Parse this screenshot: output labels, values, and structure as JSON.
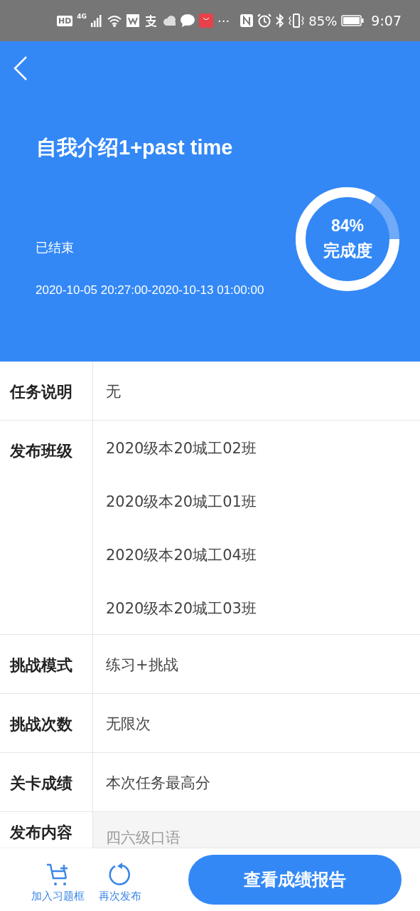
{
  "status_bar": {
    "hd": "HD",
    "network": "4G",
    "more": "···",
    "battery": "85%",
    "time": "9:07"
  },
  "header": {
    "title": "自我介绍1+past time",
    "status": "已结束",
    "time_range": "2020-10-05 20:27:00-2020-10-13 01:00:00",
    "progress": {
      "level": 0.84,
      "percent": "84%",
      "label": "完成度"
    }
  },
  "details": [
    {
      "label": "任务说明",
      "kind": "text",
      "values": [
        "无"
      ]
    },
    {
      "label": "发布班级",
      "kind": "text",
      "values": [
        "2020级本20城工02班",
        "2020级本20城工01班",
        "2020级本20城工04班",
        "2020级本20城工03班"
      ]
    },
    {
      "label": "挑战模式",
      "kind": "text",
      "values": [
        "练习+挑战"
      ]
    },
    {
      "label": "挑战次数",
      "kind": "text",
      "values": [
        "无限次"
      ]
    },
    {
      "label": "关卡成绩",
      "kind": "text",
      "values": [
        "本次任务最高分"
      ]
    },
    {
      "label": "发布内容",
      "kind": "content",
      "values": [
        "四六级口语"
      ]
    }
  ],
  "footer": {
    "actions": [
      {
        "label": "加入习题框",
        "kind": "cart"
      },
      {
        "label": "再次发布",
        "kind": "refresh"
      }
    ],
    "primary": "查看成绩报告"
  }
}
